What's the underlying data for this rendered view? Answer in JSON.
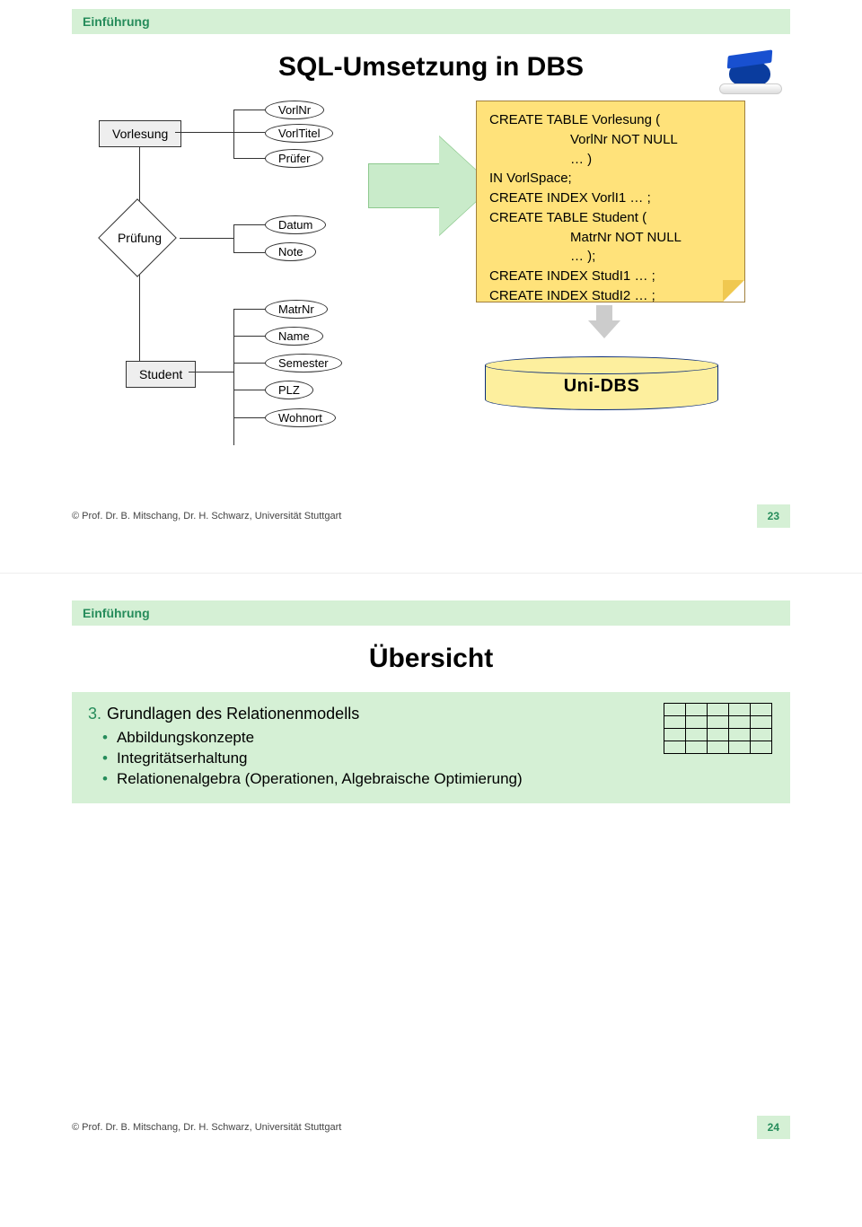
{
  "slide1": {
    "header": "Einführung",
    "title": "SQL-Umsetzung in DBS",
    "entities": {
      "vorlesung": "Vorlesung",
      "pruefung": "Prüfung",
      "student": "Student"
    },
    "attrs": {
      "vorlnr": "VorlNr",
      "vorltitel": "VorlTitel",
      "pruefer": "Prüfer",
      "datum": "Datum",
      "note": "Note",
      "matrnr": "MatrNr",
      "name": "Name",
      "semester": "Semester",
      "plz": "PLZ",
      "wohnort": "Wohnort"
    },
    "sql": {
      "l1": "CREATE TABLE Vorlesung (",
      "l2": "VorlNr   NOT NULL",
      "l3": "… )",
      "l4": "IN VorlSpace;",
      "l5": "CREATE INDEX VorlI1 … ;",
      "l6": "CREATE TABLE Student (",
      "l7": "MatrNr   NOT NULL",
      "l8": "… );",
      "l9": "CREATE INDEX StudI1 … ;",
      "l10": "CREATE INDEX StudI2 … ;"
    },
    "cylinder": "Uni-DBS",
    "footer": "© Prof. Dr. B. Mitschang, Dr. H. Schwarz, Universität Stuttgart",
    "page": "23"
  },
  "slide2": {
    "header": "Einführung",
    "title": "Übersicht",
    "section_num": "3.",
    "section_title": "Grundlagen des Relationenmodells",
    "bullets": [
      "Abbildungskonzepte",
      "Integritätserhaltung",
      "Relationenalgebra (Operationen, Algebraische Optimierung)"
    ],
    "footer": "© Prof. Dr. B. Mitschang, Dr. H. Schwarz, Universität Stuttgart",
    "page": "24"
  }
}
